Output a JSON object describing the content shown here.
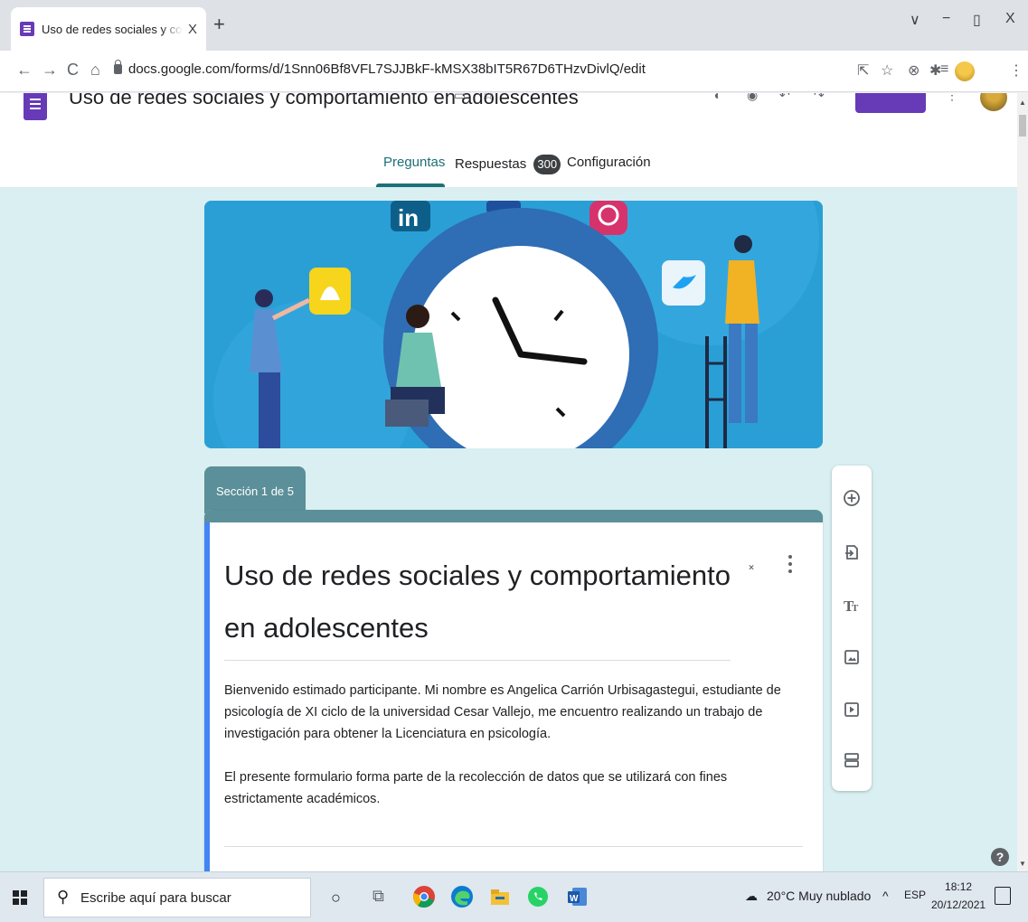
{
  "browser": {
    "tab_title": "Uso de redes sociales y comportamiento en adolescentes",
    "tab_close": "X",
    "new_tab": "+",
    "url": "docs.google.com/forms/d/1Snn06Bf8VFL7SJJBkF-kMSX38bIT5R67D6THzvDivlQ/edit",
    "window_controls": [
      "∨",
      "−",
      "▯",
      "X"
    ]
  },
  "form_header": {
    "doc_title": "Uso de redes sociales y comportamiento en adolescentes",
    "tabs": [
      {
        "label": "Preguntas",
        "active": true
      },
      {
        "label": "Respuestas",
        "badge": "300"
      },
      {
        "label": "Configuración"
      }
    ]
  },
  "section": {
    "label": "Sección 1 de 5",
    "title": "Uso  de redes sociales y comportamiento en adolescentes",
    "description": [
      "Bienvenido estimado participante. Mi nombre es Angelica Carrión Urbisagastegui, estudiante de psicología de XI ciclo de la universidad Cesar Vallejo, me encuentro realizando un trabajo de investigación para obtener la Licenciatura en psicología.",
      "El presente formulario forma parte de la recolección de datos que se utilizará con fines estrictamente académicos."
    ]
  },
  "side_toolbar": [
    "add-question-icon",
    "import-questions-icon",
    "add-title-icon",
    "add-image-icon",
    "add-video-icon",
    "add-section-icon"
  ],
  "help": "?",
  "taskbar": {
    "search_placeholder": "Escribe aquí para buscar",
    "weather": "20°C  Muy nublado",
    "tray_up": "^",
    "language": "ESP",
    "time": "18:12",
    "date": "20/12/2021"
  },
  "colors": {
    "accent": "#673ab7",
    "theme": "#5b8f99",
    "background": "#d9eff1",
    "active_tab": "#1f6f78"
  }
}
